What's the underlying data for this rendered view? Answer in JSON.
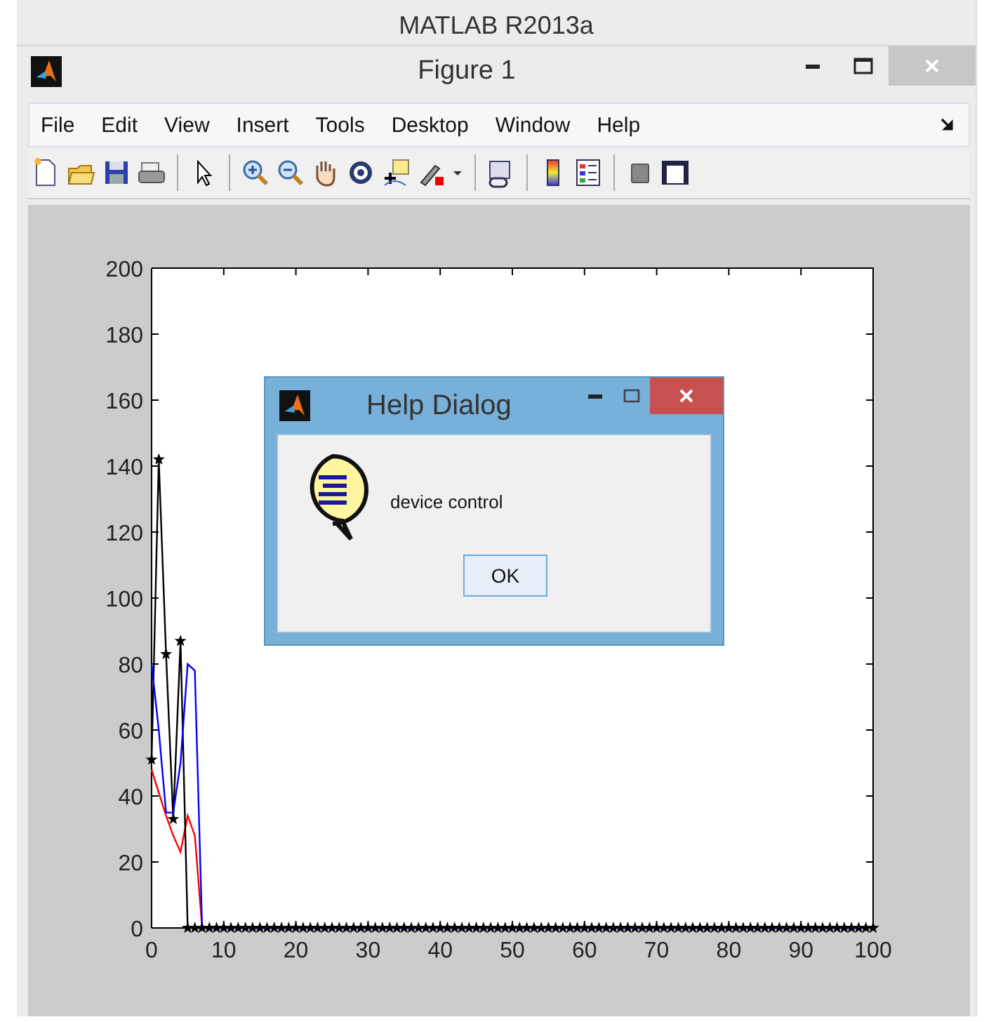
{
  "app_title": "MATLAB R2013a",
  "window": {
    "title": "Figure 1"
  },
  "menu": [
    "File",
    "Edit",
    "View",
    "Insert",
    "Tools",
    "Desktop",
    "Window",
    "Help"
  ],
  "axes": {
    "chart_data": {
      "type": "line",
      "x": [
        0,
        1,
        2,
        3,
        4,
        5,
        6,
        7,
        8,
        9,
        10,
        11,
        12,
        13,
        14,
        15,
        16,
        17,
        18,
        19,
        20,
        21,
        22,
        23,
        24,
        25,
        26,
        27,
        28,
        29,
        30,
        31,
        32,
        33,
        34,
        35,
        36,
        37,
        38,
        39,
        40,
        41,
        42,
        43,
        44,
        45,
        46,
        47,
        48,
        49,
        50,
        51,
        52,
        53,
        54,
        55,
        56,
        57,
        58,
        59,
        60,
        61,
        62,
        63,
        64,
        65,
        66,
        67,
        68,
        69,
        70,
        71,
        72,
        73,
        74,
        75,
        76,
        77,
        78,
        79,
        80,
        81,
        82,
        83,
        84,
        85,
        86,
        87,
        88,
        89,
        90,
        91,
        92,
        93,
        94,
        95,
        96,
        97,
        98,
        99,
        100
      ],
      "xlim": [
        0,
        100
      ],
      "ylim": [
        0,
        200
      ],
      "xticks": [
        0,
        10,
        20,
        30,
        40,
        50,
        60,
        70,
        80,
        90,
        100
      ],
      "yticks": [
        0,
        20,
        40,
        60,
        80,
        100,
        120,
        140,
        160,
        180,
        200
      ],
      "series": [
        {
          "color": "#ff0000",
          "marker": "none",
          "values": [
            48,
            41,
            34,
            28,
            23,
            34,
            28,
            0,
            null,
            null,
            null,
            null,
            null,
            null,
            null,
            null,
            null,
            null,
            null,
            null,
            null,
            null,
            null,
            null,
            null,
            null,
            null,
            null,
            null,
            null,
            null,
            null,
            null,
            null,
            null,
            null,
            null,
            null,
            null,
            null,
            null,
            null,
            null,
            null,
            null,
            null,
            null,
            null,
            null,
            null,
            null,
            null,
            null,
            null,
            null,
            null,
            null,
            null,
            null,
            null,
            null,
            null,
            null,
            null,
            null,
            null,
            null,
            null,
            null,
            null,
            null,
            null,
            null,
            null,
            null,
            null,
            null,
            null,
            null,
            null,
            null,
            null,
            null,
            null,
            null,
            null,
            null,
            null,
            null,
            null,
            null,
            null,
            null,
            null,
            null,
            null,
            null,
            null,
            null,
            null,
            null
          ]
        },
        {
          "color": "#000000",
          "marker": "star",
          "values": [
            51,
            142,
            83,
            33,
            87,
            0,
            0,
            0,
            0,
            0,
            0,
            0,
            0,
            0,
            0,
            0,
            0,
            0,
            0,
            0,
            0,
            0,
            0,
            0,
            0,
            0,
            0,
            0,
            0,
            0,
            0,
            0,
            0,
            0,
            0,
            0,
            0,
            0,
            0,
            0,
            0,
            0,
            0,
            0,
            0,
            0,
            0,
            0,
            0,
            0,
            0,
            0,
            0,
            0,
            0,
            0,
            0,
            0,
            0,
            0,
            0,
            0,
            0,
            0,
            0,
            0,
            0,
            0,
            0,
            0,
            0,
            0,
            0,
            0,
            0,
            0,
            0,
            0,
            0,
            0,
            0,
            0,
            0,
            0,
            0,
            0,
            0,
            0,
            0,
            0,
            0,
            0,
            0,
            0,
            0,
            0,
            0,
            0,
            0,
            0,
            0
          ]
        },
        {
          "color": "#0000ff",
          "marker": "none",
          "values": [
            80,
            60,
            35,
            35,
            50,
            80,
            78,
            0,
            0,
            0,
            0,
            0,
            0,
            0,
            0,
            0,
            0,
            0,
            0,
            0,
            0,
            0,
            0,
            0,
            0,
            0,
            0,
            0,
            0,
            0,
            0,
            0,
            0,
            0,
            0,
            0,
            0,
            0,
            0,
            0,
            0,
            0,
            0,
            0,
            0,
            0,
            0,
            0,
            0,
            0,
            0,
            0,
            0,
            0,
            0,
            0,
            0,
            0,
            0,
            0,
            0,
            0,
            0,
            0,
            0,
            0,
            0,
            0,
            0,
            0,
            0,
            0,
            0,
            0,
            0,
            0,
            0,
            0,
            0,
            0,
            0,
            0,
            0,
            0,
            0,
            0,
            0,
            0,
            0,
            0,
            0,
            0,
            0,
            0,
            0,
            0,
            0,
            0,
            0,
            0,
            0
          ]
        }
      ]
    }
  },
  "dialog": {
    "title": "Help Dialog",
    "message": "device control",
    "buttons": [
      "OK"
    ]
  }
}
